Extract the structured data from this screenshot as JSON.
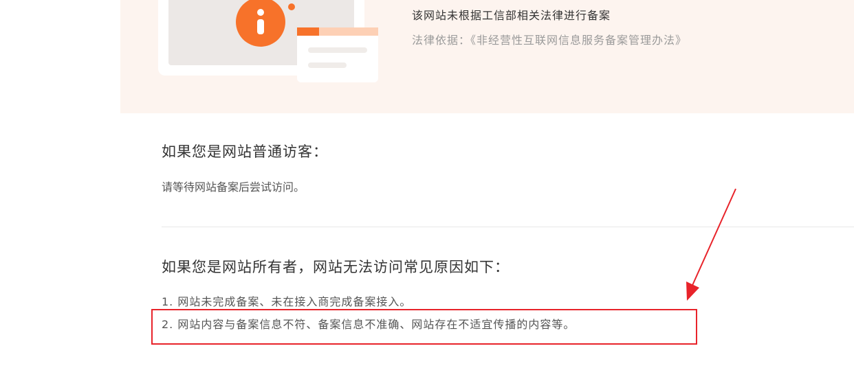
{
  "banner": {
    "notice": "该网站未根据工信部相关法律进行备案",
    "legal_basis": "法律依据：《非经营性互联网信息服务备案管理办法》"
  },
  "visitor": {
    "heading": "如果您是网站普通访客：",
    "text": "请等待网站备案后尝试访问。"
  },
  "owner": {
    "heading": "如果您是网站所有者，网站无法访问常见原因如下：",
    "reasons": [
      "1. 网站未完成备案、未在接入商完成备案接入。",
      "2. 网站内容与备案信息不符、备案信息不准确、网站存在不适宜传播的内容等。"
    ]
  },
  "colors": {
    "banner_bg": "#fdf4ef",
    "accent_orange": "#f7722a",
    "annotation_red": "#e8232a"
  },
  "icons": [
    "info-icon",
    "annotation-arrow-icon"
  ]
}
